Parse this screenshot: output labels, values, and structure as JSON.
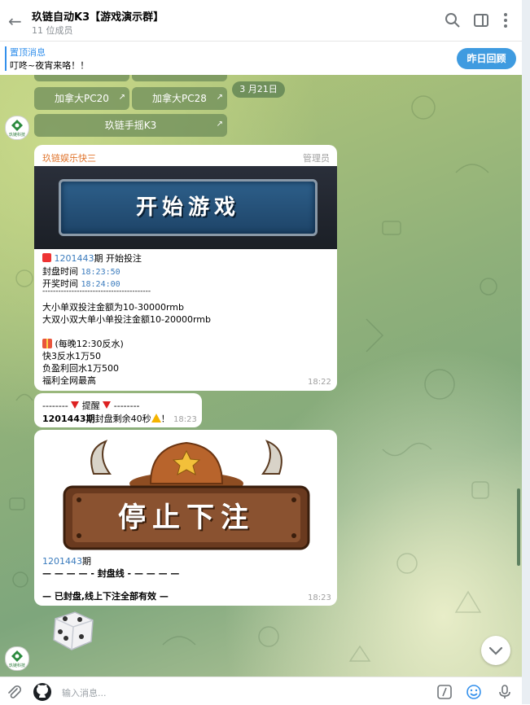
{
  "header": {
    "title": "玖链自动K3【游戏演示群】",
    "subtitle": "11 位成员"
  },
  "pinned": {
    "title": "置顶消息",
    "text": "叮咚~夜宵来咯！！",
    "button": "昨日回顾"
  },
  "keyboard": {
    "buttons": [
      "加拿大PC20",
      "加拿大PC28",
      "玖链手摇K3"
    ]
  },
  "date_pill": "3 月21日",
  "avatar_text": "玖链科技",
  "msg1": {
    "sender": "玖链娱乐快三",
    "role": "管理员",
    "banner": "开始游戏",
    "period": "1201443",
    "period_suffix": "期 开始投注",
    "close_label": "封盘时间",
    "close_time": "18:23:50",
    "draw_label": "开奖时间",
    "draw_time": "18:24:00",
    "divider": "-----------------------------------------",
    "rule1": "大小单双投注金额为10-30000rmb",
    "rule2": "大双小双大单小单投注金额10-20000rmb",
    "rebate_title": "(每晚12:30反水)",
    "rebate1": "快3反水1万50",
    "rebate2": "负盈利回水1万500",
    "rebate3": "福利全网最高",
    "time": "18:22"
  },
  "msg2": {
    "line1_prefix": "--------",
    "line1_label": "提醒",
    "line1_suffix": "--------",
    "line2_period": "1201443期",
    "line2_text": "封盘剩余40秒",
    "line2_end": "！",
    "time": "18:23"
  },
  "msg3": {
    "banner": "停止下注",
    "period": "1201443",
    "period_suffix": "期",
    "line1": "— — — — - 封盘线 - — — — —",
    "line2": "— 已封盘,线上下注全部有效 —",
    "time": "18:23"
  },
  "footer": {
    "placeholder": "输入消息..."
  },
  "colors": {
    "accent": "#3390ec",
    "sender": "#e0742c",
    "chat_bg": "#8fb07a"
  },
  "icons": [
    "back-arrow-icon",
    "search-icon",
    "sidebar-toggle-icon",
    "more-vertical-icon",
    "attach-icon",
    "github-icon",
    "commands-icon",
    "emoji-icon",
    "microphone-icon",
    "chevron-down-icon"
  ]
}
